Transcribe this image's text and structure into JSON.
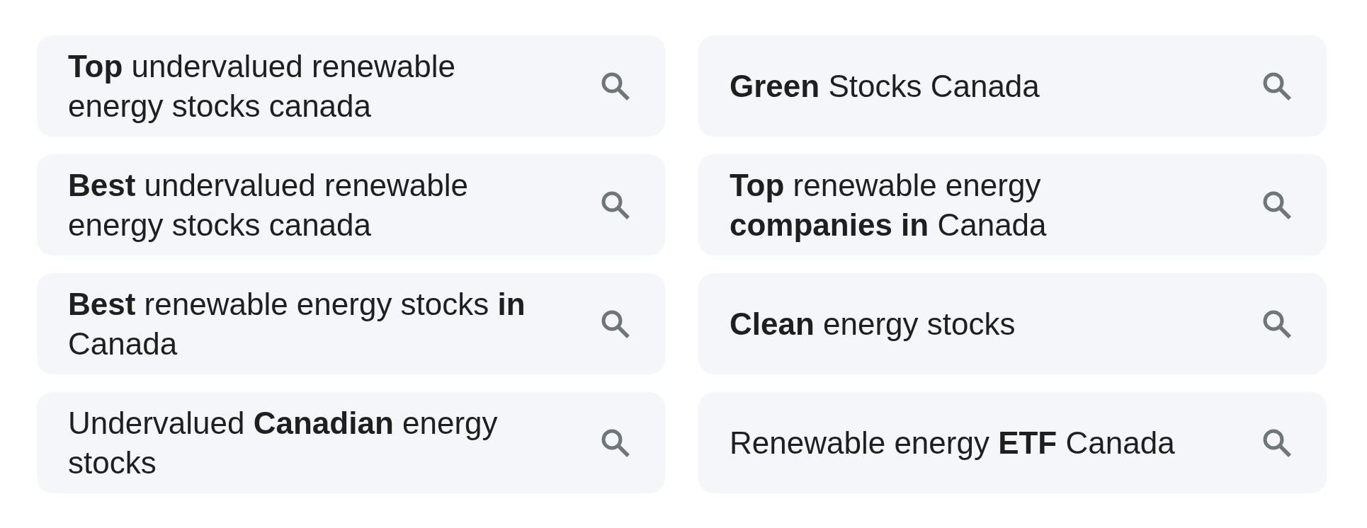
{
  "related_searches": [
    {
      "text": "**Top** undervalued renewable energy stocks canada"
    },
    {
      "text": "**Green** Stocks Canada"
    },
    {
      "text": "**Best** undervalued renewable energy stocks canada"
    },
    {
      "text": "**Top** renewable energy **companies in** Canada"
    },
    {
      "text": "**Best** renewable energy stocks **in** Canada"
    },
    {
      "text": "**Clean** energy stocks"
    },
    {
      "text": "Undervalued **Canadian** energy stocks"
    },
    {
      "text": "Renewable energy **ETF** Canada"
    }
  ]
}
